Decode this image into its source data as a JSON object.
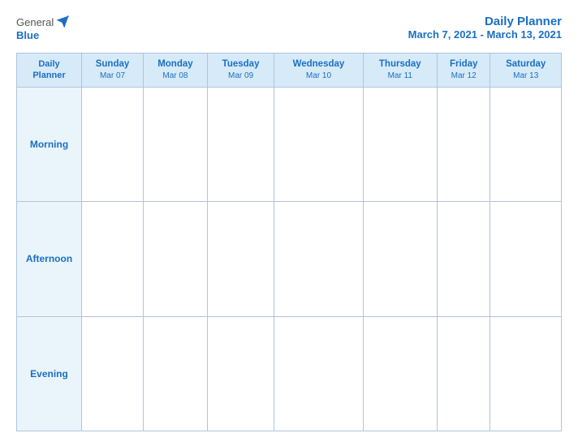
{
  "header": {
    "logo": {
      "general": "General",
      "blue": "Blue",
      "bird_icon": "bird-icon"
    },
    "title": "Daily Planner",
    "subtitle": "March 7, 2021 - March 13, 2021"
  },
  "table": {
    "header_label_line1": "Daily",
    "header_label_line2": "Planner",
    "days": [
      {
        "name": "Sunday",
        "date": "Mar 07"
      },
      {
        "name": "Monday",
        "date": "Mar 08"
      },
      {
        "name": "Tuesday",
        "date": "Mar 09"
      },
      {
        "name": "Wednesday",
        "date": "Mar 10"
      },
      {
        "name": "Thursday",
        "date": "Mar 11"
      },
      {
        "name": "Friday",
        "date": "Mar 12"
      },
      {
        "name": "Saturday",
        "date": "Mar 13"
      }
    ],
    "rows": [
      {
        "label": "Morning"
      },
      {
        "label": "Afternoon"
      },
      {
        "label": "Evening"
      }
    ]
  }
}
